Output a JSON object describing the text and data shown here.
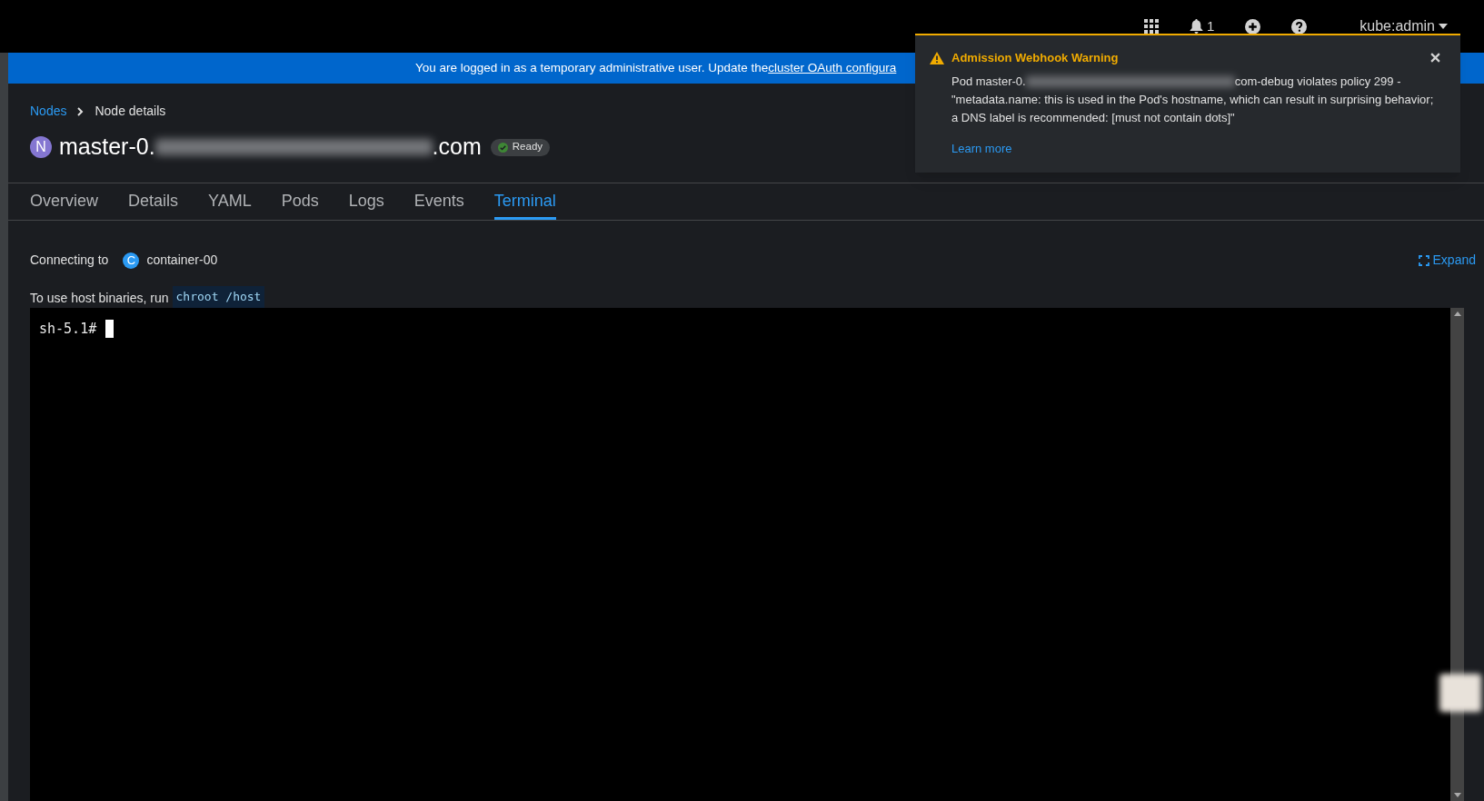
{
  "masthead": {
    "notification_count": "1",
    "user": "kube:admin"
  },
  "banner": {
    "text": "You are logged in as a temporary administrative user. Update the ",
    "link": "cluster OAuth configura"
  },
  "breadcrumb": [
    {
      "label": "Nodes",
      "kind": "link"
    },
    {
      "label": "Node details",
      "kind": "current"
    }
  ],
  "title": {
    "badge": "N",
    "name_prefix": "master-0.",
    "name_suffix": ".com",
    "status": "Ready"
  },
  "tabs": [
    {
      "label": "Overview",
      "selected": false
    },
    {
      "label": "Details",
      "selected": false
    },
    {
      "label": "YAML",
      "selected": false
    },
    {
      "label": "Pods",
      "selected": false
    },
    {
      "label": "Logs",
      "selected": false
    },
    {
      "label": "Events",
      "selected": false
    },
    {
      "label": "Terminal",
      "selected": true
    }
  ],
  "terminal": {
    "connecting_label": "Connecting to",
    "container_badge": "C",
    "container": "container-00",
    "expand": "Expand",
    "hint": "To use host binaries, run",
    "hint_command": "chroot /host",
    "prompt": "sh-5.1#"
  },
  "toast": {
    "title": "Admission Webhook Warning",
    "message_prefix": "Pod master-0.",
    "message_suffix": "com-debug violates policy 299 - \"metadata.name: this is used in the Pod's hostname, which can result in surprising behavior; a DNS label is recommended: [must not contain dots]\"",
    "link": "Learn more"
  }
}
